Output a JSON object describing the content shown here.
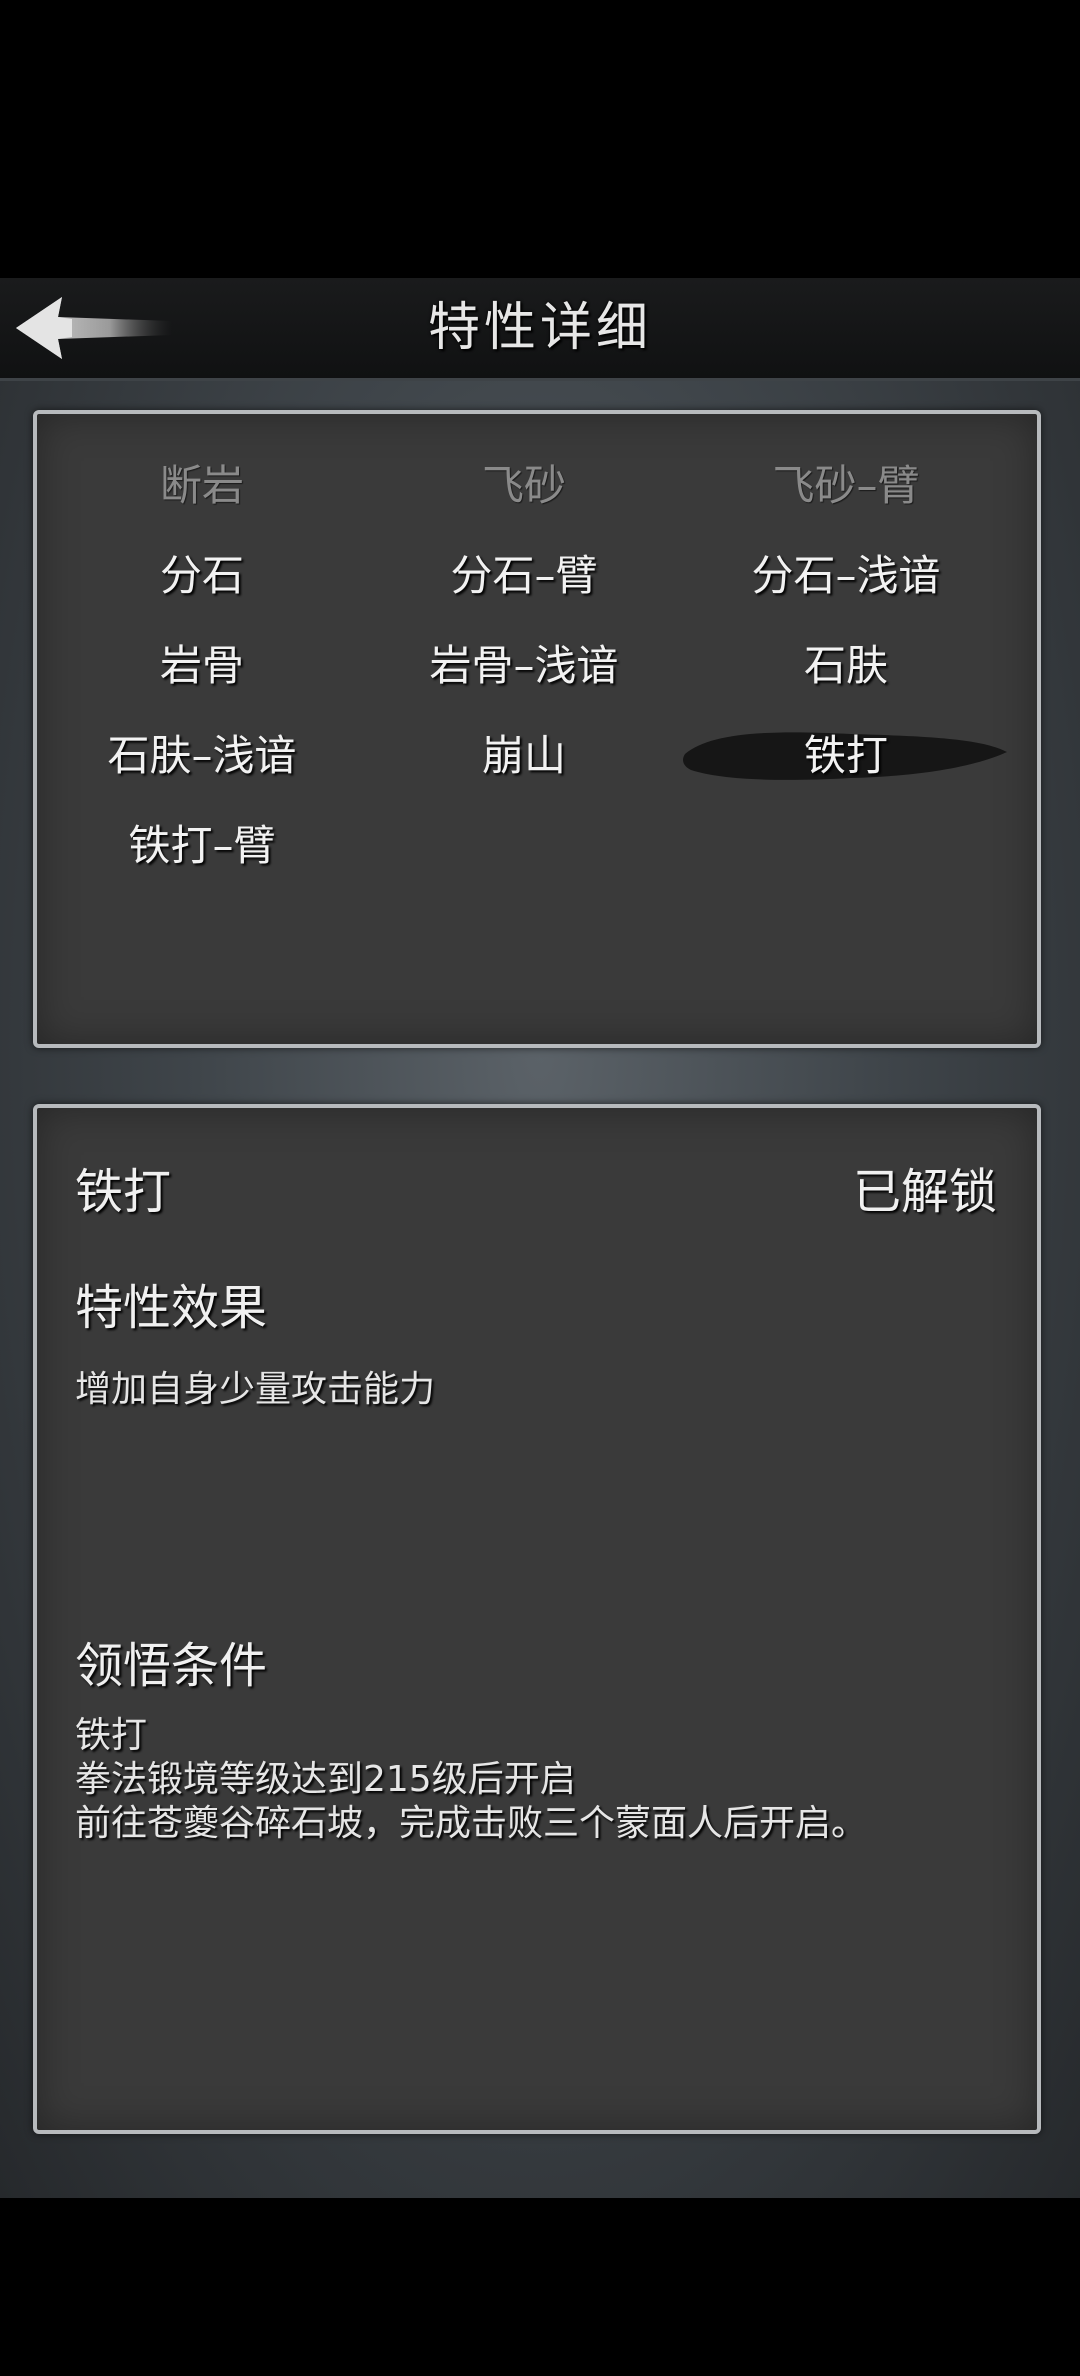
{
  "header": {
    "title": "特性详细",
    "back_icon": "arrow-left-icon"
  },
  "traits": [
    {
      "label": "断岩",
      "locked": true,
      "selected": false
    },
    {
      "label": "飞砂",
      "locked": true,
      "selected": false
    },
    {
      "label": "飞砂–臂",
      "locked": true,
      "selected": false
    },
    {
      "label": "分石",
      "locked": false,
      "selected": false
    },
    {
      "label": "分石–臂",
      "locked": false,
      "selected": false
    },
    {
      "label": "分石–浅谙",
      "locked": false,
      "selected": false
    },
    {
      "label": "岩骨",
      "locked": false,
      "selected": false
    },
    {
      "label": "岩骨–浅谙",
      "locked": false,
      "selected": false
    },
    {
      "label": "石肤",
      "locked": false,
      "selected": false
    },
    {
      "label": "石肤–浅谙",
      "locked": false,
      "selected": false
    },
    {
      "label": "崩山",
      "locked": false,
      "selected": false
    },
    {
      "label": "铁打",
      "locked": false,
      "selected": true
    },
    {
      "label": "铁打–臂",
      "locked": false,
      "selected": false
    }
  ],
  "detail": {
    "name": "铁打",
    "status": "已解锁",
    "effect_heading": "特性效果",
    "effect_text": "增加自身少量攻击能力",
    "condition_heading": "领悟条件",
    "condition_lines": [
      "铁打",
      "拳法锻境等级达到215级后开启",
      "前往苍夔谷碎石坡，完成击败三个蒙面人后开启。"
    ]
  },
  "colors": {
    "background": "#000000",
    "panel": "#3a3a3a",
    "panel_border": "#b7babd",
    "text": "#f2f2f2",
    "locked_text": "#8a8a8a",
    "selection_brush": "#141414"
  }
}
